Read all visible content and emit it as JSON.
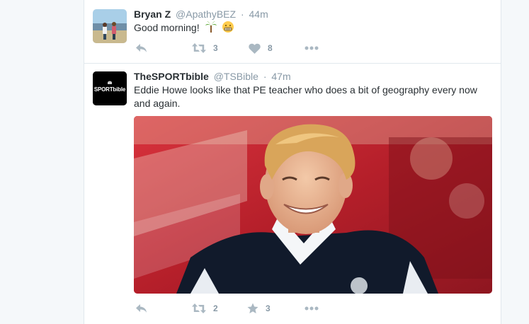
{
  "tweets": [
    {
      "fullname": "Bryan Z",
      "username": "@ApathyBEZ",
      "separator": "·",
      "time": "44m",
      "text": "Good morning!",
      "emoji": [
        "palm-tree",
        "grimace-face"
      ],
      "retweets": "3",
      "likes": "8",
      "like_icon": "heart-icon"
    },
    {
      "fullname": "TheSPORTbible",
      "username": "@TSBible",
      "separator": "·",
      "time": "47m",
      "text": "Eddie Howe looks like that PE teacher who does a bit of geography every now and again.",
      "retweets": "2",
      "likes": "3",
      "like_icon": "star-icon",
      "avatar_text": "SPORTbible"
    }
  ],
  "colors": {
    "icon_gray": "#aab8c2",
    "text_gray": "#8899a6",
    "text_dark": "#292f33",
    "border": "#e1e8ed"
  }
}
